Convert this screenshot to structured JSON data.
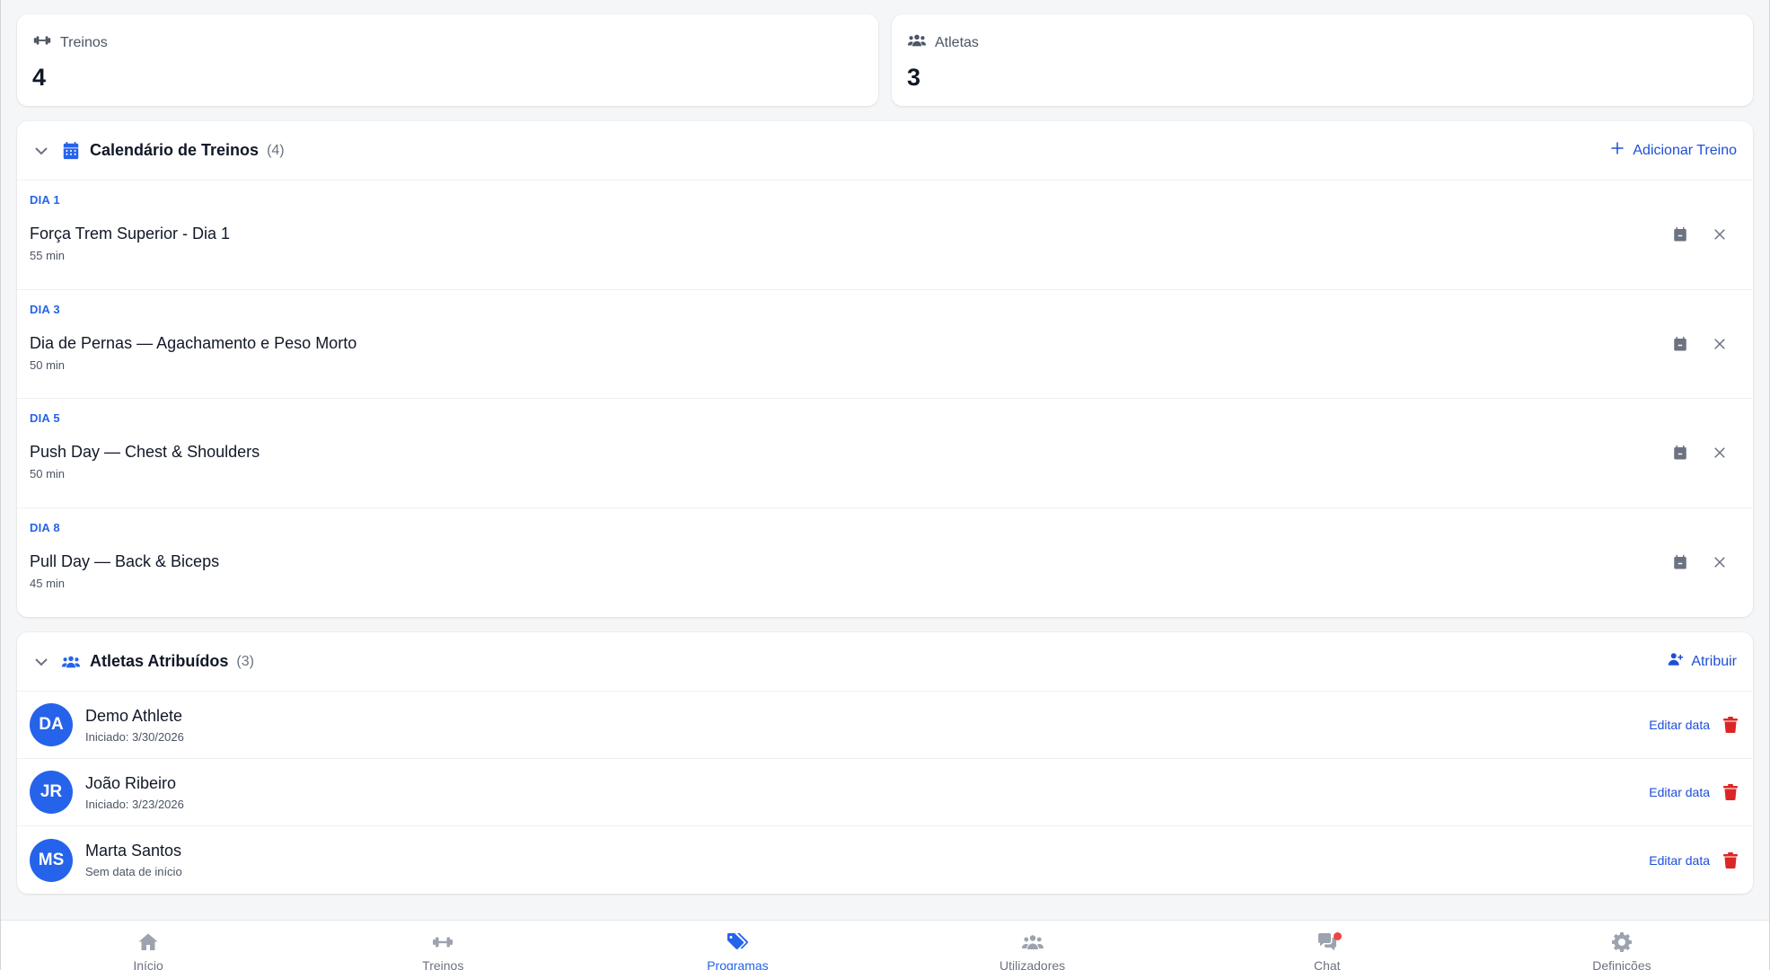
{
  "stats": {
    "workouts": {
      "label": "Treinos",
      "value": "4",
      "icon": "dumbbell-icon"
    },
    "athletes": {
      "label": "Atletas",
      "value": "3",
      "icon": "users-icon"
    }
  },
  "calendar": {
    "title": "Calendário de Treinos",
    "count": "(4)",
    "add_label": "Adicionar Treino",
    "items": [
      {
        "day": "DIA 1",
        "title": "Força Trem Superior - Dia 1",
        "duration": "55 min"
      },
      {
        "day": "DIA 3",
        "title": "Dia de Pernas — Agachamento e Peso Morto",
        "duration": "50 min"
      },
      {
        "day": "DIA 5",
        "title": "Push Day — Chest & Shoulders",
        "duration": "50 min"
      },
      {
        "day": "DIA 8",
        "title": "Pull Day — Back & Biceps",
        "duration": "45 min"
      }
    ]
  },
  "assigned": {
    "title": "Atletas Atribuídos",
    "count": "(3)",
    "assign_label": "Atribuir",
    "edit_label": "Editar data",
    "items": [
      {
        "initials": "DA",
        "name": "Demo Athlete",
        "subtitle": "Iniciado: 3/30/2026"
      },
      {
        "initials": "JR",
        "name": "João Ribeiro",
        "subtitle": "Iniciado: 3/23/2026"
      },
      {
        "initials": "MS",
        "name": "Marta Santos",
        "subtitle": "Sem data de início"
      }
    ]
  },
  "nav": {
    "items": [
      {
        "label": "Início",
        "icon": "home-icon"
      },
      {
        "label": "Treinos",
        "icon": "dumbbell-icon"
      },
      {
        "label": "Programas",
        "icon": "tags-icon",
        "active": true
      },
      {
        "label": "Utilizadores",
        "icon": "users-icon"
      },
      {
        "label": "Chat",
        "icon": "chat-icon",
        "badge": true
      },
      {
        "label": "Definições",
        "icon": "gear-icon"
      }
    ]
  },
  "colors": {
    "accent": "#2563eb",
    "danger": "#dc2626",
    "badge": "#ef4444"
  }
}
